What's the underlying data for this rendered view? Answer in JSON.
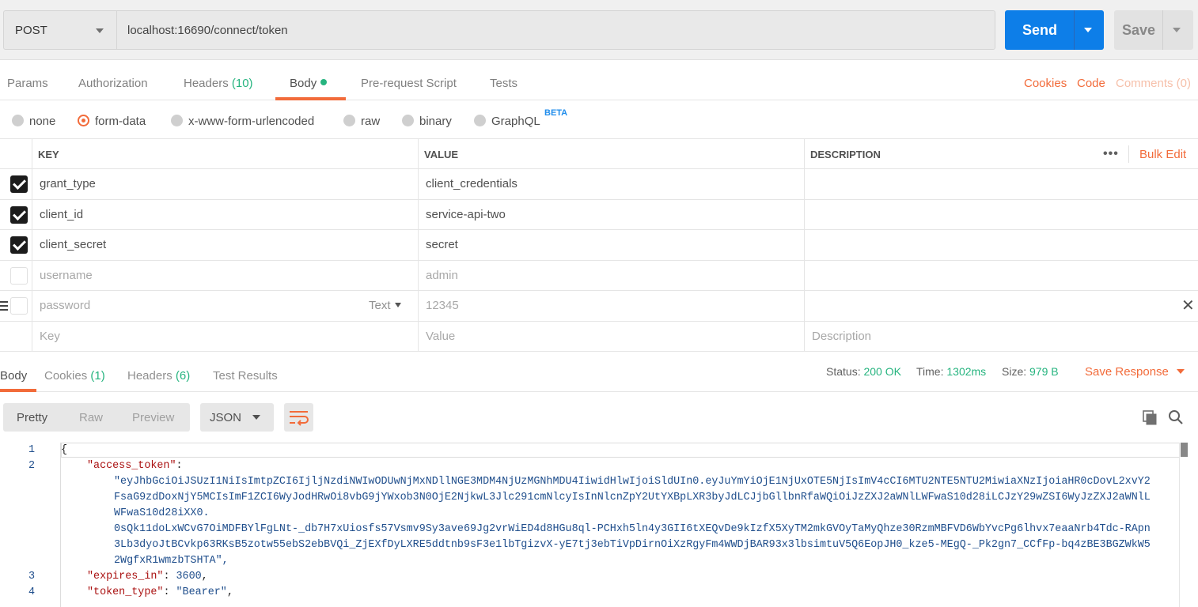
{
  "request": {
    "method": "POST",
    "url": "localhost:16690/connect/token",
    "send_label": "Send",
    "save_label": "Save"
  },
  "request_tabs": {
    "params": "Params",
    "authorization": "Authorization",
    "headers": "Headers",
    "headers_count": "(10)",
    "body": "Body",
    "prerequest": "Pre-request Script",
    "tests": "Tests",
    "cookies": "Cookies",
    "code": "Code",
    "comments": "Comments (0)"
  },
  "body_types": {
    "none": "none",
    "form_data": "form-data",
    "urlencoded": "x-www-form-urlencoded",
    "raw": "raw",
    "binary": "binary",
    "graphql": "GraphQL",
    "beta": "BETA",
    "selected": "form-data"
  },
  "kv_table": {
    "headers": {
      "key": "KEY",
      "value": "VALUE",
      "description": "DESCRIPTION"
    },
    "more": "•••",
    "bulk_edit": "Bulk Edit",
    "rows": [
      {
        "key": "grant_type",
        "value": "client_credentials",
        "checked": true
      },
      {
        "key": "client_id",
        "value": "service-api-two",
        "checked": true
      },
      {
        "key": "client_secret",
        "value": "secret",
        "checked": true
      },
      {
        "key": "username",
        "value": "admin",
        "checked": false
      },
      {
        "key": "password",
        "value": "12345",
        "checked": false,
        "type": "Text"
      }
    ],
    "placeholder": {
      "key": "Key",
      "value": "Value",
      "description": "Description"
    }
  },
  "response_tabs": {
    "body": "Body",
    "cookies": "Cookies",
    "cookies_count": "(1)",
    "headers": "Headers",
    "headers_count": "(6)",
    "test_results": "Test Results",
    "status_label": "Status:",
    "status_value": "200 OK",
    "time_label": "Time:",
    "time_value": "1302ms",
    "size_label": "Size:",
    "size_value": "979 B",
    "save_response": "Save Response"
  },
  "response_toolbar": {
    "pretty": "Pretty",
    "raw": "Raw",
    "preview": "Preview",
    "format": "JSON"
  },
  "response_body": {
    "line_numbers": [
      "1",
      "2",
      "3",
      "4"
    ],
    "open_brace": "{",
    "access_token_key": "\"access_token\"",
    "access_token_lines": [
      "\"eyJhbGciOiJSUzI1NiIsImtpZCI6IjljNzdiNWIwODUwNjMxNDllNGE3MDM4NjUzMGNhMDU4IiwidHlwIjoiSldUIn0.eyJuYmYiOjE1NjUxOTE5NjIsImV4cCI6MTU2NTE5NTU2MiwiaXNzIjoiaHR0cDovL2xvY2",
      "FsaG9zdDoxNjY5MCIsImF1ZCI6WyJodHRwOi8vbG9jYWxob3N0OjE2NjkwL3Jlc291cmNlcyIsInNlcnZpY2UtYXBpLXR3byJdLCJjbGllbnRfaWQiOiJzZXJ2aWNlLWFwaS10d28iLCJzY29wZSI6WyJzZXJ2aWNlL",
      "WFwaS10d28iXX0.",
      "0sQk11doLxWCvG7OiMDFBYlFgLNt-_db7H7xUiosfs57Vsmv9Sy3ave69Jg2vrWiED4d8HGu8ql-PCHxh5ln4y3GII6tXEQvDe9kIzfX5XyTM2mkGVOyTaMyQhze30RzmMBFVD6WbYvcPg6lhvx7eaaNrb4Tdc-RApn",
      "3Lb3dyoJtBCvkp63RKsB5zotw55ebS2ebBVQi_ZjEXfDyLXRE5ddtnb9sF3e1lbTgizvX-yE7tj3ebTiVpDirnOiXzRgyFm4WWDjBAR93x3lbsimtuV5Q6EopJH0_kze5-MEgQ-_Pk2gn7_CCfFp-bq4zBE3BGZWkW5",
      "2WgfxR1wmzbTSHTA\","
    ],
    "expires_in_key": "\"expires_in\"",
    "expires_in_value": "3600",
    "token_type_key": "\"token_type\"",
    "token_type_value": "\"Bearer\""
  },
  "colors": {
    "accent": "#f26b3a",
    "send_blue": "#0d7ee8",
    "success_green": "#26b47f"
  }
}
